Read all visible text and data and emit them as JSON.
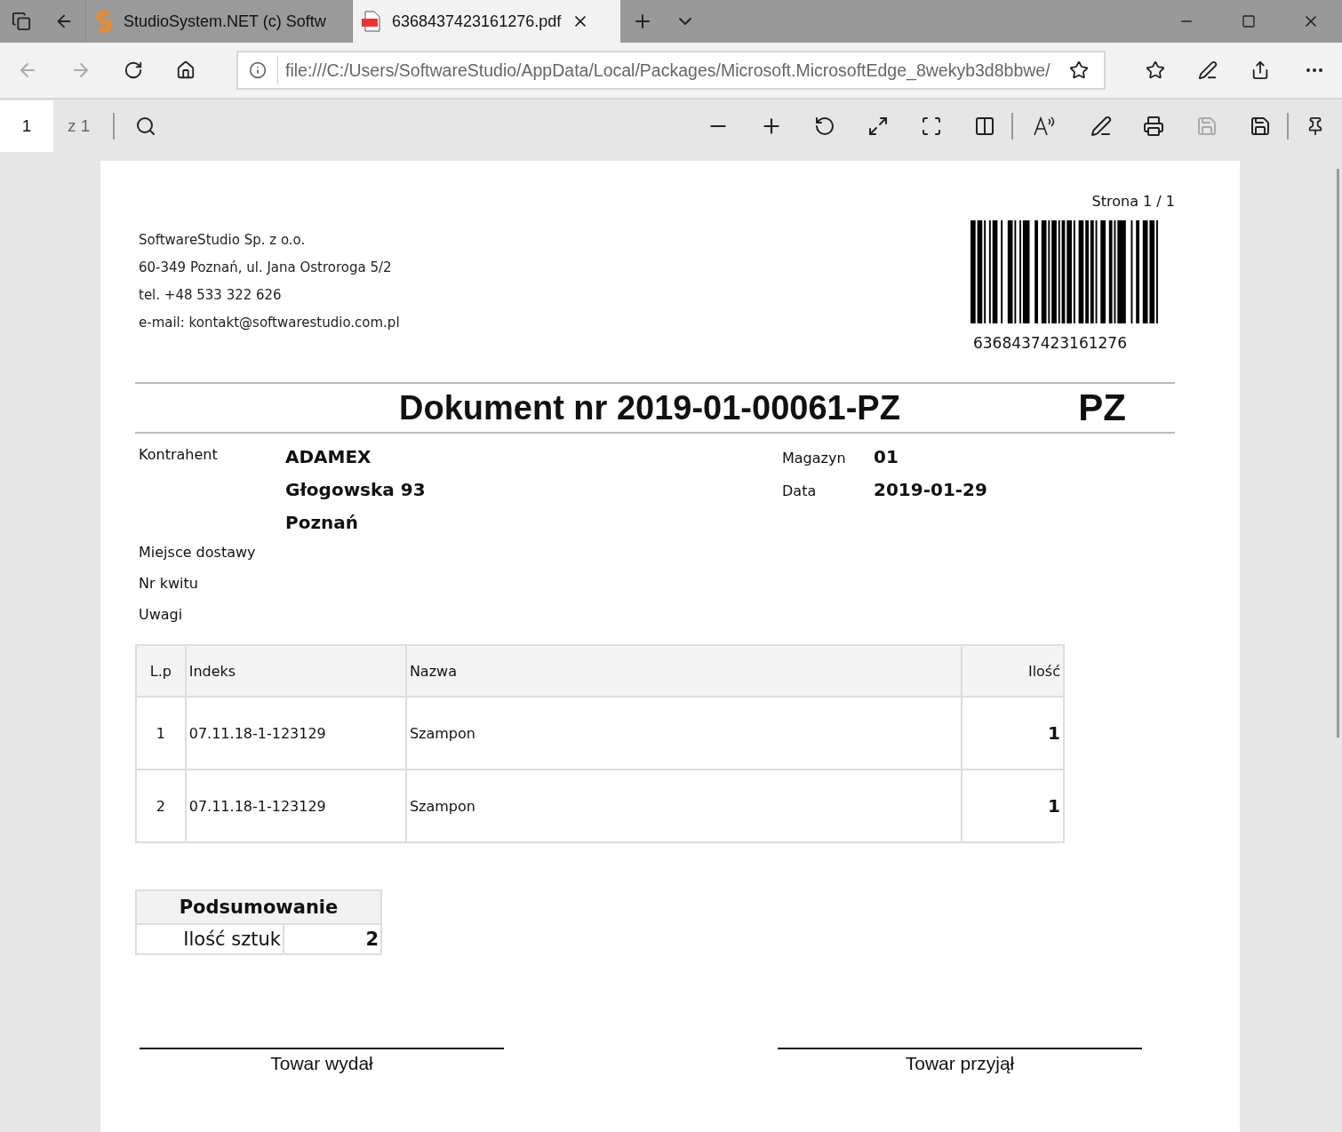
{
  "browser_tabs": [
    {
      "kind": "app",
      "title": "StudioSystem.NET (c) Softw",
      "selected": false
    },
    {
      "kind": "pdf",
      "title": "6368437423161276.pdf",
      "selected": true
    }
  ],
  "address_bar": {
    "url": "file:///C:/Users/SoftwareStudio/AppData/Local/Packages/Microsoft.MicrosoftEdge_8wekyb3d8bbwe/"
  },
  "pdf_toolbar": {
    "page": "1",
    "page_count": "z 1"
  },
  "document": {
    "page_label": "Strona 1 / 1",
    "barcode_number": "6368437423161276",
    "company_lines": [
      "SoftwareStudio Sp. z o.o.",
      "60-349 Poznań, ul. Jana Ostroroga 5/2",
      "tel. +48 533 322 626",
      "e-mail: kontakt@softwarestudio.com.pl"
    ],
    "title": "Dokument nr 2019-01-00061-PZ",
    "doc_type": "PZ",
    "contractor": {
      "label": "Kontrahent",
      "lines": [
        "ADAMEX",
        "Głogowska 93",
        "Poznań"
      ]
    },
    "fields": [
      {
        "label": "Magazyn",
        "value": "01"
      },
      {
        "label": "Data",
        "value": "2019-01-29"
      }
    ],
    "extra_labels": [
      "Miejsce dostawy",
      "Nr kwitu",
      "Uwagi"
    ],
    "table": {
      "columns": [
        "L.p",
        "Indeks",
        "Nazwa",
        "Ilość"
      ],
      "rows": [
        [
          "1",
          "07.11.18-1-123129",
          "Szampon",
          "1"
        ],
        [
          "2",
          "07.11.18-1-123129",
          "Szampon",
          "1"
        ]
      ]
    },
    "summary": {
      "title": "Podsumowanie",
      "label": "Ilość sztuk",
      "value": "2"
    },
    "signatures": [
      "Towar wydał",
      "Towar przyjął"
    ]
  }
}
